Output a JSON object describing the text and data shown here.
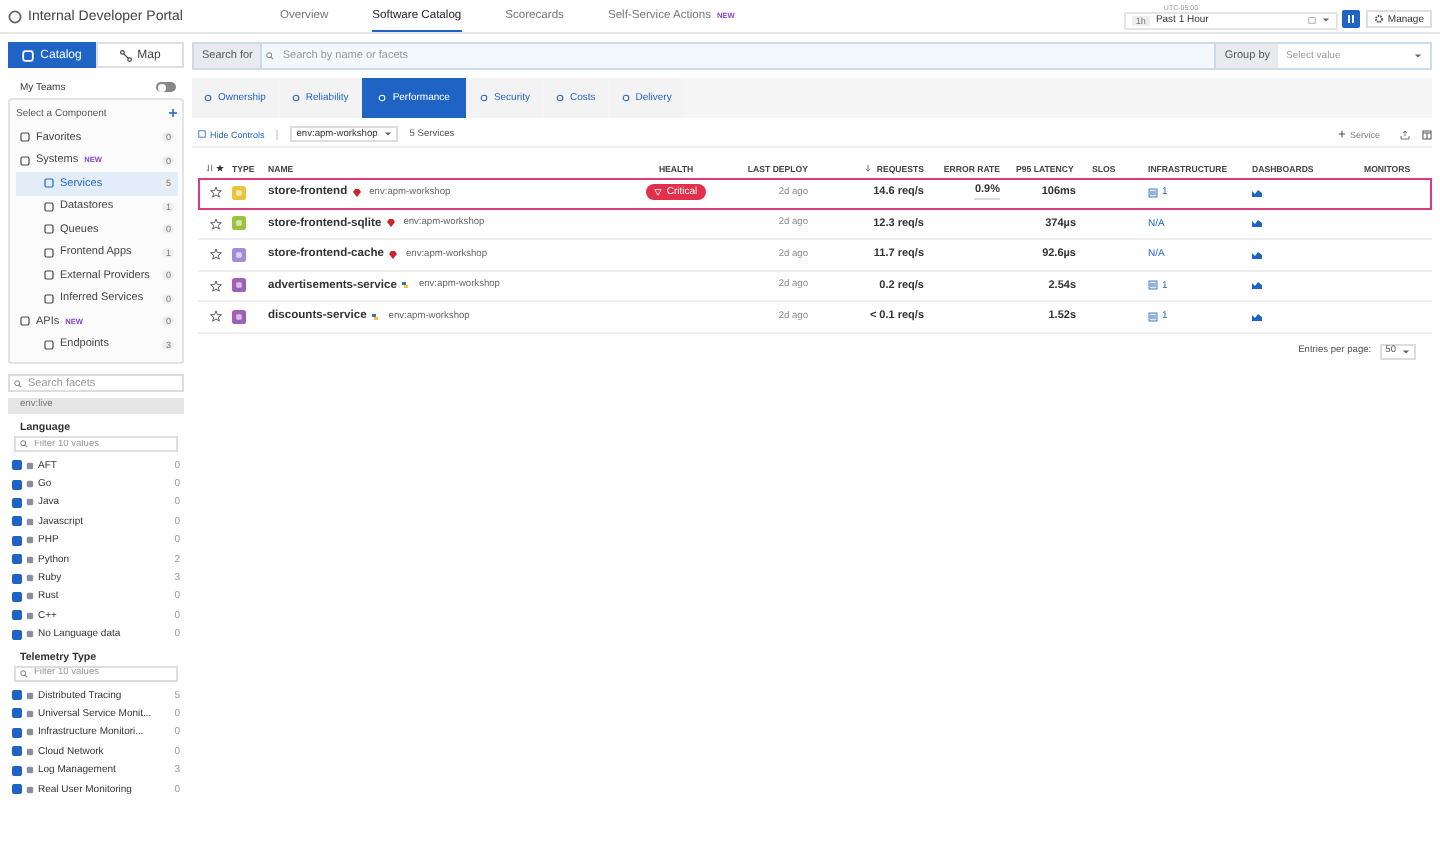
{
  "header": {
    "title": "Internal Developer Portal",
    "nav": [
      {
        "label": "Overview",
        "selected": false
      },
      {
        "label": "Software Catalog",
        "selected": true
      },
      {
        "label": "Scorecards",
        "selected": false
      },
      {
        "label": "Self-Service Actions",
        "selected": false,
        "badge": "NEW"
      }
    ],
    "time": {
      "zone": "UTC-05:00",
      "short": "1h",
      "label": "Past 1 Hour"
    },
    "manage": "Manage"
  },
  "sidebar": {
    "view_tabs": [
      {
        "label": "Catalog",
        "selected": true
      },
      {
        "label": "Map",
        "selected": false
      }
    ],
    "my_teams": {
      "label": "My Teams",
      "on": false
    },
    "component_title": "Select a Component",
    "components": [
      {
        "label": "Favorites",
        "count": "0",
        "selected": false
      },
      {
        "label": "Systems",
        "badge": "NEW",
        "count": "0",
        "selected": false,
        "children": [
          {
            "label": "Services",
            "count": "5",
            "selected": true
          },
          {
            "label": "Datastores",
            "count": "1",
            "selected": false
          },
          {
            "label": "Queues",
            "count": "0",
            "selected": false
          },
          {
            "label": "Frontend Apps",
            "count": "1",
            "selected": false
          },
          {
            "label": "External Providers",
            "count": "0",
            "selected": false
          },
          {
            "label": "Inferred Services",
            "count": "0",
            "selected": false
          }
        ]
      },
      {
        "label": "APIs",
        "badge": "NEW",
        "count": "0",
        "selected": false,
        "children": [
          {
            "label": "Endpoints",
            "count": "3",
            "selected": false
          }
        ]
      }
    ],
    "facet_search": {
      "placeholder": "Search facets"
    },
    "env_facet": "env:live",
    "facet_groups": [
      {
        "title": "Language",
        "filter_placeholder": "Filter 10 values",
        "items": [
          {
            "label": "AFT",
            "count": "0",
            "checked": true
          },
          {
            "label": "Go",
            "count": "0",
            "checked": true
          },
          {
            "label": "Java",
            "count": "0",
            "checked": true
          },
          {
            "label": "Javascript",
            "count": "0",
            "checked": true
          },
          {
            "label": "PHP",
            "count": "0",
            "checked": true
          },
          {
            "label": "Python",
            "count": "2",
            "checked": true
          },
          {
            "label": "Ruby",
            "count": "3",
            "checked": true
          },
          {
            "label": "Rust",
            "count": "0",
            "checked": true
          },
          {
            "label": "C++",
            "count": "0",
            "checked": true
          },
          {
            "label": "No Language data",
            "count": "0",
            "checked": true
          }
        ]
      },
      {
        "title": "Telemetry Type",
        "filter_placeholder": "Filter 10 values",
        "items": [
          {
            "label": "Distributed Tracing",
            "count": "5",
            "checked": true
          },
          {
            "label": "Universal Service Monit...",
            "count": "0",
            "checked": true
          },
          {
            "label": "Infrastructure Monitori...",
            "count": "0",
            "checked": true
          },
          {
            "label": "Cloud Network",
            "count": "0",
            "checked": true
          },
          {
            "label": "Log Management",
            "count": "3",
            "checked": true
          },
          {
            "label": "Real User Monitoring",
            "count": "0",
            "checked": true
          }
        ]
      }
    ]
  },
  "search": {
    "label": "Search for",
    "placeholder": "Search by name or facets",
    "group_label": "Group by",
    "group_placeholder": "Select value"
  },
  "tabs": [
    {
      "label": "Ownership",
      "selected": false
    },
    {
      "label": "Reliability",
      "selected": false
    },
    {
      "label": "Performance",
      "selected": true
    },
    {
      "label": "Security",
      "selected": false
    },
    {
      "label": "Costs",
      "selected": false
    },
    {
      "label": "Delivery",
      "selected": false
    }
  ],
  "controls": {
    "hide": "Hide Controls",
    "env": "env:apm-workshop",
    "count": "5 Services",
    "add": "Service"
  },
  "table": {
    "columns": [
      "TYPE",
      "NAME",
      "HEALTH",
      "LAST DEPLOY",
      "REQUESTS",
      "ERROR RATE",
      "P95 LATENCY",
      "SLOS",
      "INFRASTRUCTURE",
      "DASHBOARDS",
      "MONITORS"
    ],
    "rows": [
      {
        "selected": true,
        "color": "#e8c53a",
        "name": "store-frontend",
        "kind": "ruby",
        "env": "env:apm-workshop",
        "health": "Critical",
        "deploy": "2d ago",
        "requests": "14.6 req/s",
        "error_rate": "0.9%",
        "latency": "106ms",
        "infra": "1"
      },
      {
        "selected": false,
        "color": "#9ac43c",
        "name": "store-frontend-sqlite",
        "kind": "ruby",
        "env": "env:apm-workshop",
        "deploy": "2d ago",
        "requests": "12.3 req/s",
        "latency": "374µs",
        "infra": "N/A"
      },
      {
        "selected": false,
        "color": "#a58ad6",
        "name": "store-frontend-cache",
        "kind": "ruby",
        "env": "env:apm-workshop",
        "deploy": "2d ago",
        "requests": "11.7 req/s",
        "latency": "92.6µs",
        "infra": "N/A"
      },
      {
        "selected": false,
        "color": "#9d5fb8",
        "name": "advertisements-service",
        "kind": "python",
        "env": "env:apm-workshop",
        "deploy": "2d ago",
        "requests": "0.2 req/s",
        "latency": "2.54s",
        "infra": "1"
      },
      {
        "selected": false,
        "color": "#9d5fb8",
        "name": "discounts-service",
        "kind": "python",
        "env": "env:apm-workshop",
        "deploy": "2d ago",
        "requests": "< 0.1 req/s",
        "latency": "1.52s",
        "infra": "1"
      }
    ]
  },
  "pagination": {
    "label": "Entries per page:",
    "value": "50"
  }
}
